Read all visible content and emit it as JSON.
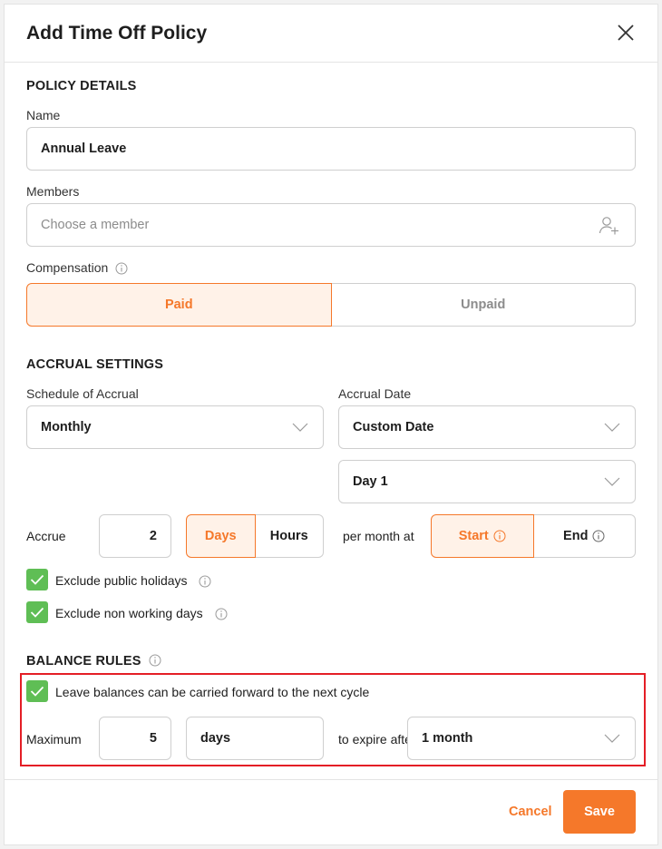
{
  "modal": {
    "title": "Add Time Off Policy"
  },
  "policy_details": {
    "section_title": "POLICY DETAILS",
    "name_label": "Name",
    "name_value": "Annual Leave",
    "members_label": "Members",
    "members_placeholder": "Choose a member",
    "compensation_label": "Compensation",
    "compensation_options": [
      "Paid",
      "Unpaid"
    ],
    "compensation_selected": "Paid"
  },
  "accrual_settings": {
    "section_title": "ACCRUAL SETTINGS",
    "schedule_label": "Schedule of Accrual",
    "schedule_value": "Monthly",
    "date_label": "Accrual Date",
    "date_value": "Custom Date",
    "day_value": "Day 1",
    "accrue_label": "Accrue",
    "accrue_amount": "2",
    "unit_options": [
      "Days",
      "Hours"
    ],
    "unit_selected": "Days",
    "per_month_label": "per month at",
    "timing_options": [
      "Start",
      "End"
    ],
    "timing_selected": "Start",
    "exclude_holidays_label": "Exclude public holidays",
    "exclude_non_working_label": "Exclude non working days"
  },
  "balance_rules": {
    "section_title": "BALANCE RULES",
    "carry_forward_label": "Leave balances can be carried forward to the next cycle",
    "maximum_label": "Maximum",
    "maximum_value": "5",
    "maximum_unit": "days",
    "expire_label": "to expire after",
    "expire_value": "1 month"
  },
  "footer": {
    "cancel_label": "Cancel",
    "save_label": "Save"
  },
  "colors": {
    "accent": "#f5782a",
    "check": "#5fbe55",
    "highlight": "#e41e26"
  }
}
